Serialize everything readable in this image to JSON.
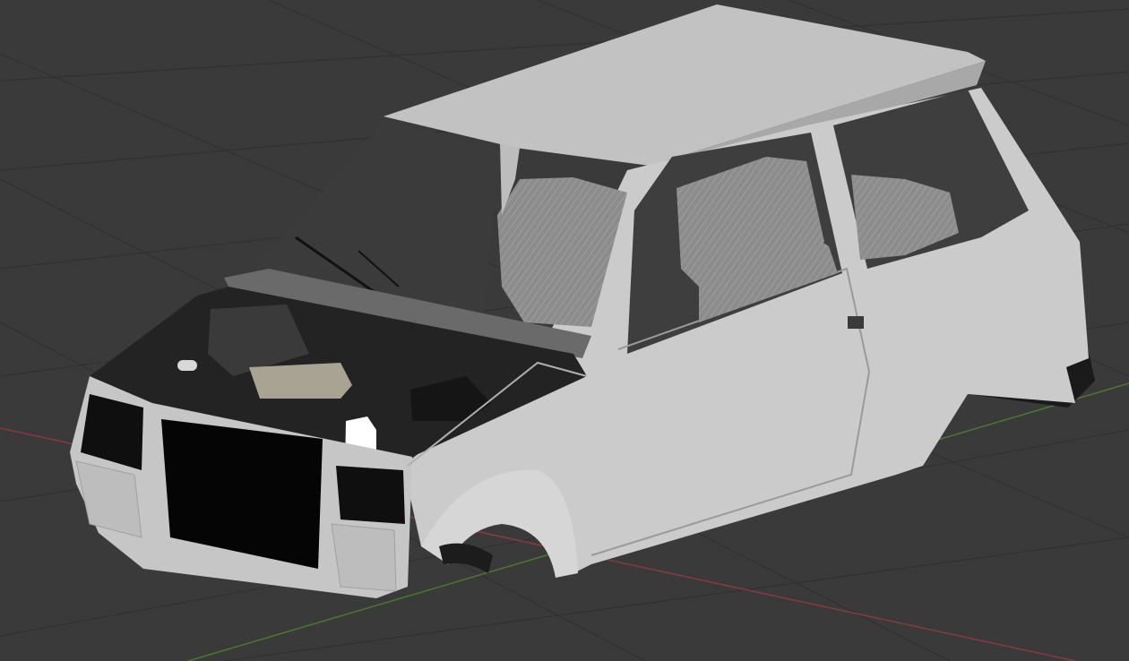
{
  "viewport": {
    "background_color": "#3a3a3a",
    "grid_color": "#2f2f2f",
    "x_axis_color": "#8a3b3b",
    "y_axis_color": "#4a7a2e"
  },
  "model": {
    "body_color": "#c9c9c9",
    "body_shade_color": "#b3b3b3",
    "glass_color": "#3e3e3e",
    "seat_color": "#8c8c8c",
    "engine_color": "#2a2a2a"
  }
}
